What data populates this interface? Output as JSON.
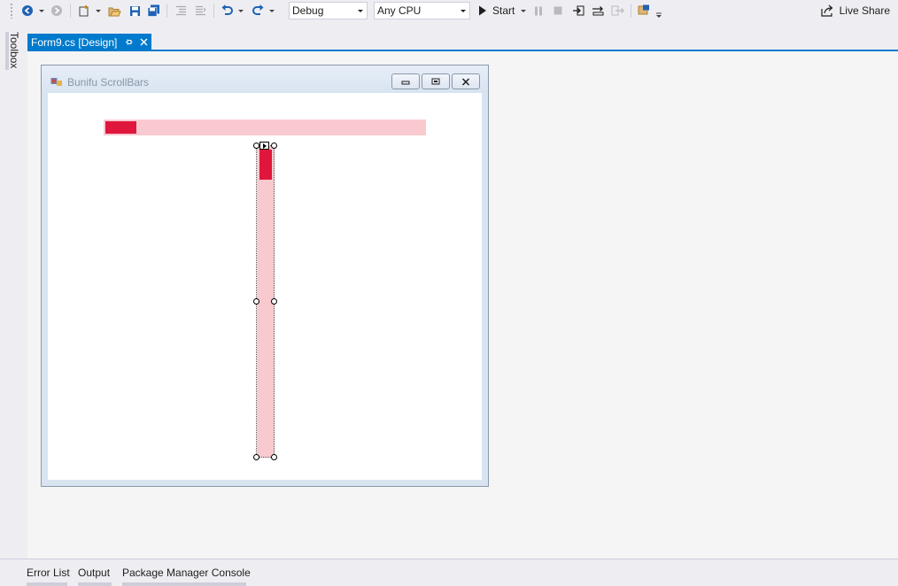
{
  "toolbar": {
    "configuration": "Debug",
    "platform": "Any CPU",
    "start_label": "Start",
    "live_share_label": "Live Share",
    "icons": [
      "back-icon",
      "forward-icon",
      "new-project-icon",
      "open-file-icon",
      "save-icon",
      "save-all-icon",
      "comment-icon",
      "uncomment-icon",
      "undo-icon",
      "redo-icon",
      "start-icon",
      "pause-icon",
      "stop-icon",
      "step-into-icon",
      "step-over-icon",
      "step-out-icon",
      "find-icon",
      "live-share-icon"
    ]
  },
  "toolbox": {
    "label": "Toolbox"
  },
  "document_tab": {
    "title": "Form9.cs [Design]",
    "active_color": "#007acc"
  },
  "form": {
    "title": "Bunifu ScrollBars",
    "scrollbar_track_color": "#f8cad0",
    "scrollbar_thumb_color": "#e0173d"
  },
  "horizontal_scrollbar": {
    "value_fraction": 0.0
  },
  "vertical_scrollbar": {
    "value_fraction": 0.0,
    "selected": true
  },
  "bottom_tabs": [
    {
      "label": "Error List"
    },
    {
      "label": "Output"
    },
    {
      "label": "Package Manager Console"
    }
  ]
}
